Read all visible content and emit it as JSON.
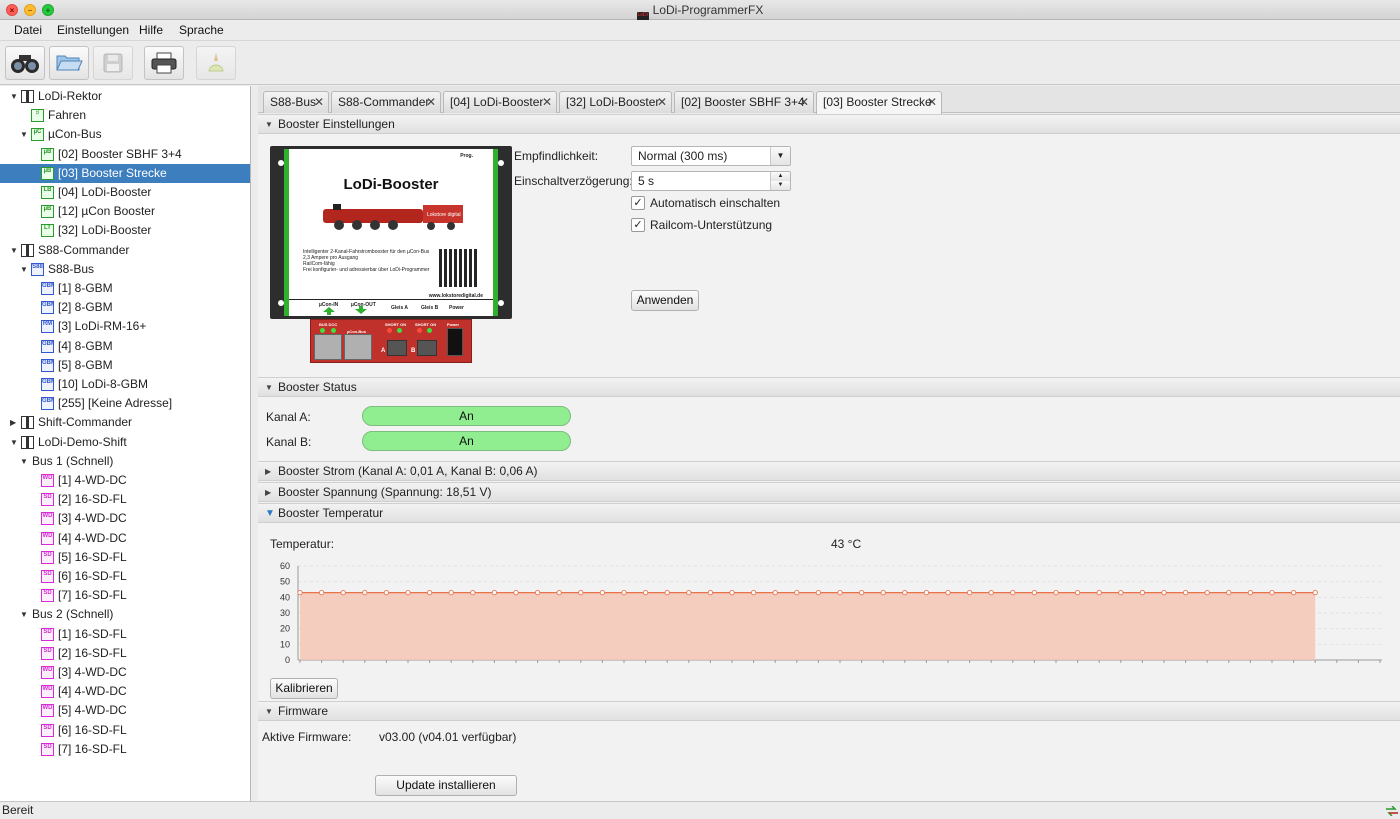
{
  "window": {
    "title": "LoDi-ProgrammerFX",
    "app_icon_text": "LoDi"
  },
  "menu": [
    "Datei",
    "Einstellungen",
    "Hilfe",
    "Sprache"
  ],
  "toolbar": [
    {
      "icon": "binoculars-icon",
      "enabled": true
    },
    {
      "icon": "folder-open-icon",
      "enabled": true
    },
    {
      "icon": "save-disk-icon",
      "enabled": false
    },
    {
      "icon": "printer-icon",
      "enabled": true
    },
    {
      "icon": "clean-brush-icon",
      "enabled": false
    }
  ],
  "tree": [
    {
      "label": "LoDi-Rektor",
      "level": 0,
      "expander": "expanded",
      "icon": "device"
    },
    {
      "label": "Fahren",
      "level": 1,
      "expander": "none",
      "icon": "green",
      "icon_text": "♯"
    },
    {
      "label": "µCon-Bus",
      "level": 1,
      "expander": "expanded",
      "icon": "green",
      "icon_text": "µC"
    },
    {
      "label": "[02] Booster SBHF 3+4",
      "level": 2,
      "expander": "none",
      "icon": "green",
      "icon_text": "µB"
    },
    {
      "label": "[03] Booster Strecke",
      "level": 2,
      "expander": "none",
      "icon": "green",
      "icon_text": "µB",
      "selected": true
    },
    {
      "label": "[04] LoDi-Booster",
      "level": 2,
      "expander": "none",
      "icon": "green",
      "icon_text": "LB"
    },
    {
      "label": "[12] µCon Booster",
      "level": 2,
      "expander": "none",
      "icon": "green",
      "icon_text": "µB"
    },
    {
      "label": "[32] LoDi-Booster",
      "level": 2,
      "expander": "none",
      "icon": "green",
      "icon_text": "LT"
    },
    {
      "label": "S88-Commander",
      "level": 0,
      "expander": "expanded",
      "icon": "device"
    },
    {
      "label": "S88-Bus",
      "level": 1,
      "expander": "expanded",
      "icon": "blue",
      "icon_text": "S88"
    },
    {
      "label": "[1] 8-GBM",
      "level": 2,
      "expander": "none",
      "icon": "blue",
      "icon_text": "GBM"
    },
    {
      "label": "[2] 8-GBM",
      "level": 2,
      "expander": "none",
      "icon": "blue",
      "icon_text": "GBM"
    },
    {
      "label": "[3] LoDi-RM-16+",
      "level": 2,
      "expander": "none",
      "icon": "blue",
      "icon_text": "RM"
    },
    {
      "label": "[4] 8-GBM",
      "level": 2,
      "expander": "none",
      "icon": "blue",
      "icon_text": "GBM"
    },
    {
      "label": "[5] 8-GBM",
      "level": 2,
      "expander": "none",
      "icon": "blue",
      "icon_text": "GBM"
    },
    {
      "label": "[10] LoDi-8-GBM",
      "level": 2,
      "expander": "none",
      "icon": "blue",
      "icon_text": "GBM"
    },
    {
      "label": "[255] [Keine Adresse]",
      "level": 2,
      "expander": "none",
      "icon": "blue",
      "icon_text": "GBM"
    },
    {
      "label": "Shift-Commander",
      "level": 0,
      "expander": "collapsed",
      "icon": "device"
    },
    {
      "label": "LoDi-Demo-Shift",
      "level": 0,
      "expander": "expanded",
      "icon": "device"
    },
    {
      "label": "Bus 1 (Schnell)",
      "level": 1,
      "expander": "expanded",
      "icon": "none"
    },
    {
      "label": "[1] 4-WD-DC",
      "level": 2,
      "expander": "none",
      "icon": "magenta",
      "icon_text": "WD"
    },
    {
      "label": "[2] 16-SD-FL",
      "level": 2,
      "expander": "none",
      "icon": "magenta",
      "icon_text": "SD"
    },
    {
      "label": "[3] 4-WD-DC",
      "level": 2,
      "expander": "none",
      "icon": "magenta",
      "icon_text": "WD"
    },
    {
      "label": "[4] 4-WD-DC",
      "level": 2,
      "expander": "none",
      "icon": "magenta",
      "icon_text": "WD"
    },
    {
      "label": "[5] 16-SD-FL",
      "level": 2,
      "expander": "none",
      "icon": "magenta",
      "icon_text": "SD"
    },
    {
      "label": "[6] 16-SD-FL",
      "level": 2,
      "expander": "none",
      "icon": "magenta",
      "icon_text": "SD"
    },
    {
      "label": "[7] 16-SD-FL",
      "level": 2,
      "expander": "none",
      "icon": "magenta",
      "icon_text": "SD"
    },
    {
      "label": "Bus 2 (Schnell)",
      "level": 1,
      "expander": "expanded",
      "icon": "none"
    },
    {
      "label": "[1] 16-SD-FL",
      "level": 2,
      "expander": "none",
      "icon": "magenta",
      "icon_text": "SD"
    },
    {
      "label": "[2] 16-SD-FL",
      "level": 2,
      "expander": "none",
      "icon": "magenta",
      "icon_text": "SD"
    },
    {
      "label": "[3] 4-WD-DC",
      "level": 2,
      "expander": "none",
      "icon": "magenta",
      "icon_text": "WD"
    },
    {
      "label": "[4] 4-WD-DC",
      "level": 2,
      "expander": "none",
      "icon": "magenta",
      "icon_text": "WD"
    },
    {
      "label": "[5] 4-WD-DC",
      "level": 2,
      "expander": "none",
      "icon": "magenta",
      "icon_text": "WD"
    },
    {
      "label": "[6] 16-SD-FL",
      "level": 2,
      "expander": "none",
      "icon": "magenta",
      "icon_text": "SD"
    },
    {
      "label": "[7] 16-SD-FL",
      "level": 2,
      "expander": "none",
      "icon": "magenta",
      "icon_text": "SD"
    }
  ],
  "tabs": [
    {
      "label": "S88-Bus",
      "active": false
    },
    {
      "label": "S88-Commander",
      "active": false
    },
    {
      "label": "[04] LoDi-Booster",
      "active": false
    },
    {
      "label": "[32] LoDi-Booster",
      "active": false
    },
    {
      "label": "[02] Booster SBHF 3+4",
      "active": false
    },
    {
      "label": "[03] Booster Strecke",
      "active": true
    }
  ],
  "tab_close_glyph": "✕",
  "settings": {
    "header": "Booster Einstellungen",
    "sensitivity_label": "Empfindlichkeit:",
    "sensitivity_value": "Normal (300 ms)",
    "delay_label": "Einschaltverzögerung:",
    "delay_value": "5 s",
    "auto_on_label": "Automatisch einschalten",
    "auto_on_checked": true,
    "railcom_label": "Railcom-Unterstützung",
    "railcom_checked": true,
    "apply_button": "Anwenden",
    "image": {
      "title": "LoDi-Booster",
      "prog": "Prog.",
      "bullets": [
        "Intelligenter 2-Kanal-Fahrstrombooster für den µCon-Bus",
        "2,3 Ampere pro Ausgang",
        "RailCom-fähig",
        "Frei konfigurier- und adressierbar über LoDi-Programmer"
      ],
      "url": "www.lokstoredigital.de",
      "port_in": "µCon-IN",
      "port_out": "µCon-OUT",
      "gleis_a": "Gleis A",
      "gleis_b": "Gleis B",
      "power": "Power",
      "bus_label": "µCon-Bus",
      "power_small": "Power",
      "a": "A",
      "b": "B",
      "loco_brand": "Lokstore digital",
      "ind_left": "BUS DCC",
      "ind_a": "SHORT ON",
      "ind_b": "SHORT ON"
    }
  },
  "status": {
    "header": "Booster Status",
    "channel_a_label": "Kanal A:",
    "channel_a_value": "An",
    "channel_b_label": "Kanal B:",
    "channel_b_value": "An",
    "on_color": "#90ee90"
  },
  "current": {
    "header": "Booster Strom (Kanal A: 0,01 A, Kanal B: 0,06 A)"
  },
  "voltage": {
    "header": "Booster Spannung (Spannung: 18,51 V)"
  },
  "temperature": {
    "header": "Booster Temperatur",
    "label": "Temperatur:",
    "value": "43 °C",
    "calibrate_button": "Kalibrieren"
  },
  "firmware": {
    "header": "Firmware",
    "active_label": "Aktive Firmware:",
    "active_value": "v03.00 (v04.01 verfügbar)",
    "update_button": "Update installieren"
  },
  "statusbar": {
    "text": "Bereit"
  },
  "chart_data": {
    "type": "area",
    "title": "",
    "xlabel": "",
    "ylabel": "",
    "ylim": [
      0,
      60
    ],
    "yticks": [
      0,
      10,
      20,
      30,
      40,
      50,
      60
    ],
    "grid": true,
    "series": [
      {
        "values": [
          43,
          43,
          43,
          43,
          43,
          43,
          43,
          43,
          43,
          43,
          43,
          43,
          43,
          43,
          43,
          43,
          43,
          43,
          43,
          43,
          43,
          43,
          43,
          43,
          43,
          43,
          43,
          43,
          43,
          43,
          43,
          43,
          43,
          43,
          43,
          43,
          43,
          43,
          43,
          43,
          43,
          43,
          43,
          43,
          43,
          43,
          43,
          43
        ]
      }
    ],
    "line_color": "#e8734a",
    "fill_color": "#f5c7b6"
  }
}
